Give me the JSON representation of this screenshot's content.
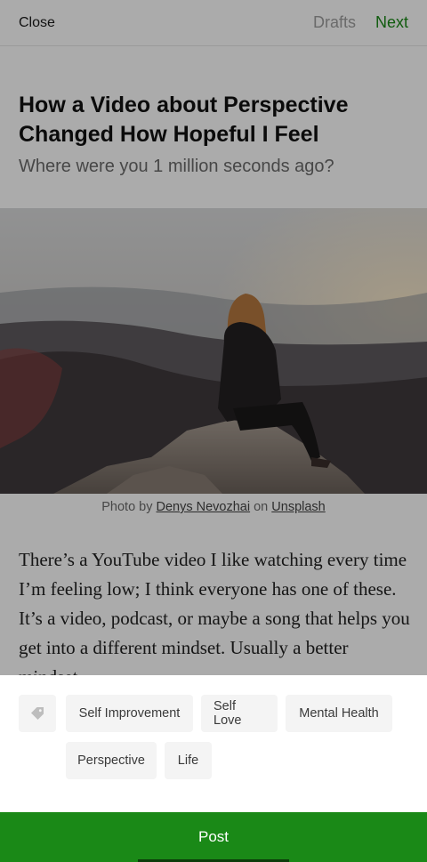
{
  "topbar": {
    "close": "Close",
    "drafts": "Drafts",
    "next": "Next"
  },
  "article": {
    "title": "How a Video about Perspective Changed How Hopeful I Feel",
    "subtitle": "Where were you 1 million seconds ago?",
    "caption": {
      "prefix": "Photo by ",
      "author": "Denys Nevozhai",
      "middle": " on ",
      "source": "Unsplash"
    },
    "body": "There’s a YouTube video I like watching every time I’m feeling low; I think everyone has one of these. It’s a video, podcast, or maybe a song that helps you get into a different mindset. Usually a better mindset."
  },
  "tags": {
    "icon": "tag-icon",
    "items": [
      "Self Improvement",
      "Self Love",
      "Mental Health",
      "Perspective",
      "Life"
    ]
  },
  "post_label": "Post",
  "colors": {
    "accent": "#1a8917",
    "overlay": "rgba(0,0,0,0.33)"
  }
}
